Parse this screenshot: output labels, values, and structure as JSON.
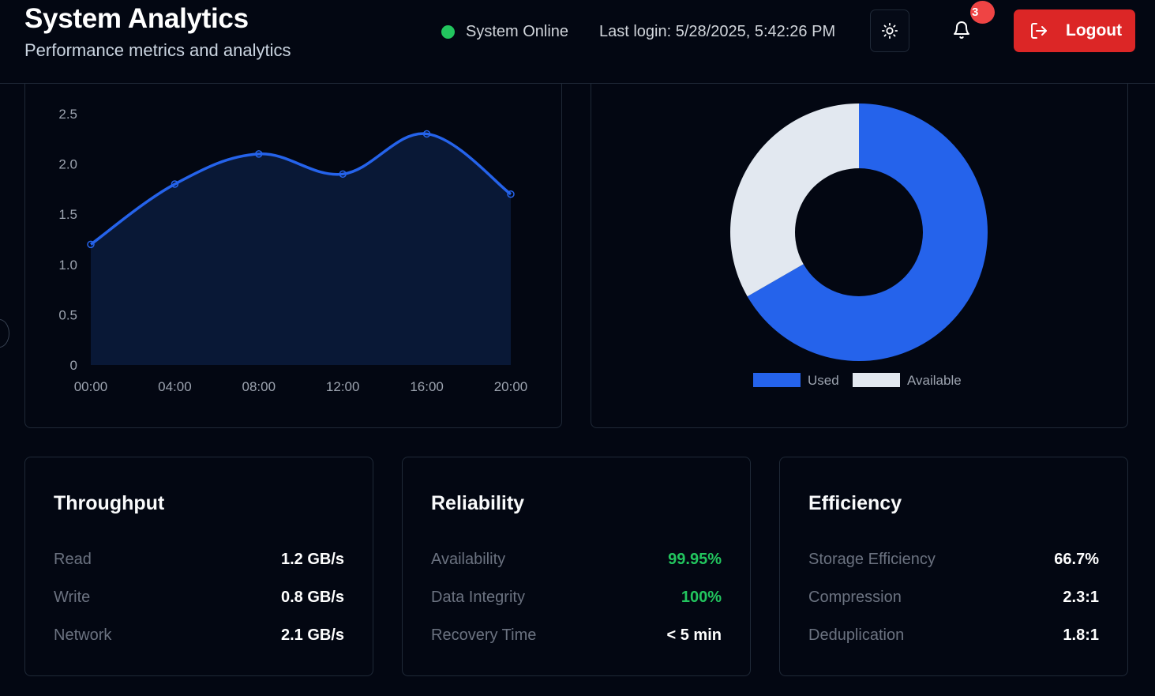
{
  "header": {
    "title": "System Analytics",
    "subtitle": "Performance metrics and analytics",
    "status": "System Online",
    "last_login": "Last login: 5/28/2025, 5:42:26 PM",
    "notification_count": "3",
    "logout_label": "Logout"
  },
  "colors": {
    "accent": "#2563eb",
    "available": "#e2e8f0",
    "success": "#22c55e",
    "danger": "#dc2626",
    "background": "#030712"
  },
  "chart_data": [
    {
      "type": "area",
      "title": "",
      "xlabel": "",
      "ylabel": "",
      "x": [
        "00:00",
        "04:00",
        "08:00",
        "12:00",
        "16:00",
        "20:00"
      ],
      "series": [
        {
          "values": [
            1.2,
            1.8,
            2.1,
            1.9,
            2.3,
            1.7
          ]
        }
      ],
      "yticks": [
        "0",
        "0.5",
        "1.0",
        "1.5",
        "2.0",
        "2.5"
      ],
      "ylim": [
        0,
        2.5
      ],
      "smooth": true,
      "grid": false
    },
    {
      "type": "pie",
      "donut": true,
      "categories": [
        "Used",
        "Available"
      ],
      "values": [
        66.7,
        33.3
      ],
      "legend": "bottom"
    }
  ],
  "stats": [
    {
      "title": "Throughput",
      "rows": [
        {
          "label": "Read",
          "value": "1.2 GB/s"
        },
        {
          "label": "Write",
          "value": "0.8 GB/s"
        },
        {
          "label": "Network",
          "value": "2.1 GB/s"
        }
      ]
    },
    {
      "title": "Reliability",
      "rows": [
        {
          "label": "Availability",
          "value": "99.95%"
        },
        {
          "label": "Data Integrity",
          "value": "100%"
        },
        {
          "label": "Recovery Time",
          "value": "< 5 min"
        }
      ]
    },
    {
      "title": "Efficiency",
      "rows": [
        {
          "label": "Storage Efficiency",
          "value": "66.7%"
        },
        {
          "label": "Compression",
          "value": "2.3:1"
        },
        {
          "label": "Deduplication",
          "value": "1.8:1"
        }
      ]
    }
  ]
}
